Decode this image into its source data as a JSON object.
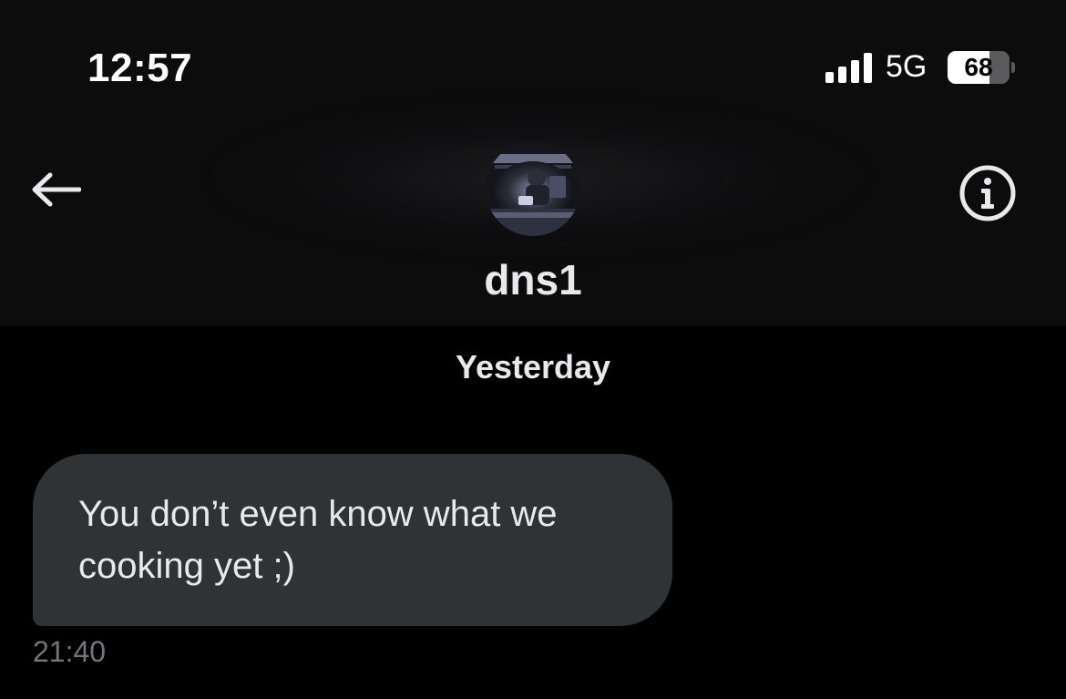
{
  "status_bar": {
    "time": "12:57",
    "network": "5G",
    "battery_percent": "68",
    "battery_level": 0.68,
    "signal_bars": 4
  },
  "header": {
    "back_icon": "arrow-left-icon",
    "info_icon": "info-circle-icon",
    "username": "dns1",
    "avatar": "profile-avatar"
  },
  "conversation": {
    "date_separator": "Yesterday",
    "messages": [
      {
        "text": "You don’t even know what we cooking yet ;)",
        "time": "21:40",
        "direction": "incoming"
      }
    ]
  },
  "colors": {
    "background": "#000000",
    "header_background": "#0c0c0d",
    "bubble_incoming": "#2f3336",
    "primary_text": "#e7e9ea",
    "secondary_text": "#71767b"
  }
}
